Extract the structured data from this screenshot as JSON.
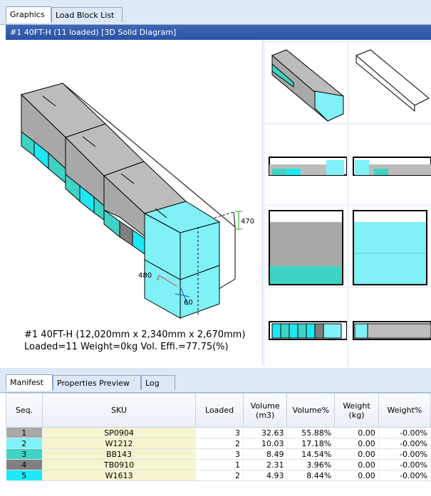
{
  "tabs": [
    "Graphics",
    "Load Block List"
  ],
  "title": "#1 40FT-H (11 loaded) [3D Solid Diagram]",
  "dims": {
    "height": "470",
    "width": "480",
    "gap": "60"
  },
  "caption": {
    "line1": "#1 40FT-H (12,020mm x 2,340mm x 2,670mm)",
    "line2": "Loaded=11 Weight=0kg Vol. Effi.=77.75(%)"
  },
  "bottom_tabs": [
    "Manifest",
    "Properties Preview",
    "Log"
  ],
  "columns": [
    "Seq.",
    "SKU",
    "Loaded",
    "Volume\n(m3)",
    "Volume%",
    "Weight\n(kg)",
    "Weight%"
  ],
  "rows": [
    {
      "seq": "1",
      "sku": "SP0904",
      "loaded": "3",
      "volume": "32.63",
      "volpct": "55.88%",
      "weight": "0.00",
      "wpct": "-0.00%",
      "color": "#a8a8a8"
    },
    {
      "seq": "2",
      "sku": "W1212",
      "loaded": "2",
      "volume": "10.03",
      "volpct": "17.18%",
      "weight": "0.00",
      "wpct": "-0.00%",
      "color": "#7ff1f7"
    },
    {
      "seq": "3",
      "sku": "BB143",
      "loaded": "3",
      "volume": "8.49",
      "volpct": "14.54%",
      "weight": "0.00",
      "wpct": "-0.00%",
      "color": "#3ed3c4"
    },
    {
      "seq": "4",
      "sku": "TB0910",
      "loaded": "1",
      "volume": "2.31",
      "volpct": "3.96%",
      "weight": "0.00",
      "wpct": "-0.00%",
      "color": "#808080"
    },
    {
      "seq": "5",
      "sku": "W1613",
      "loaded": "2",
      "volume": "4.93",
      "volpct": "8.44%",
      "weight": "0.00",
      "wpct": "-0.00%",
      "color": "#1ee8f5"
    }
  ],
  "colors": {
    "gray": "#bcbcbc",
    "cyan": "#7ff1f7",
    "teal": "#3ed3c4",
    "dark": "#808080"
  }
}
